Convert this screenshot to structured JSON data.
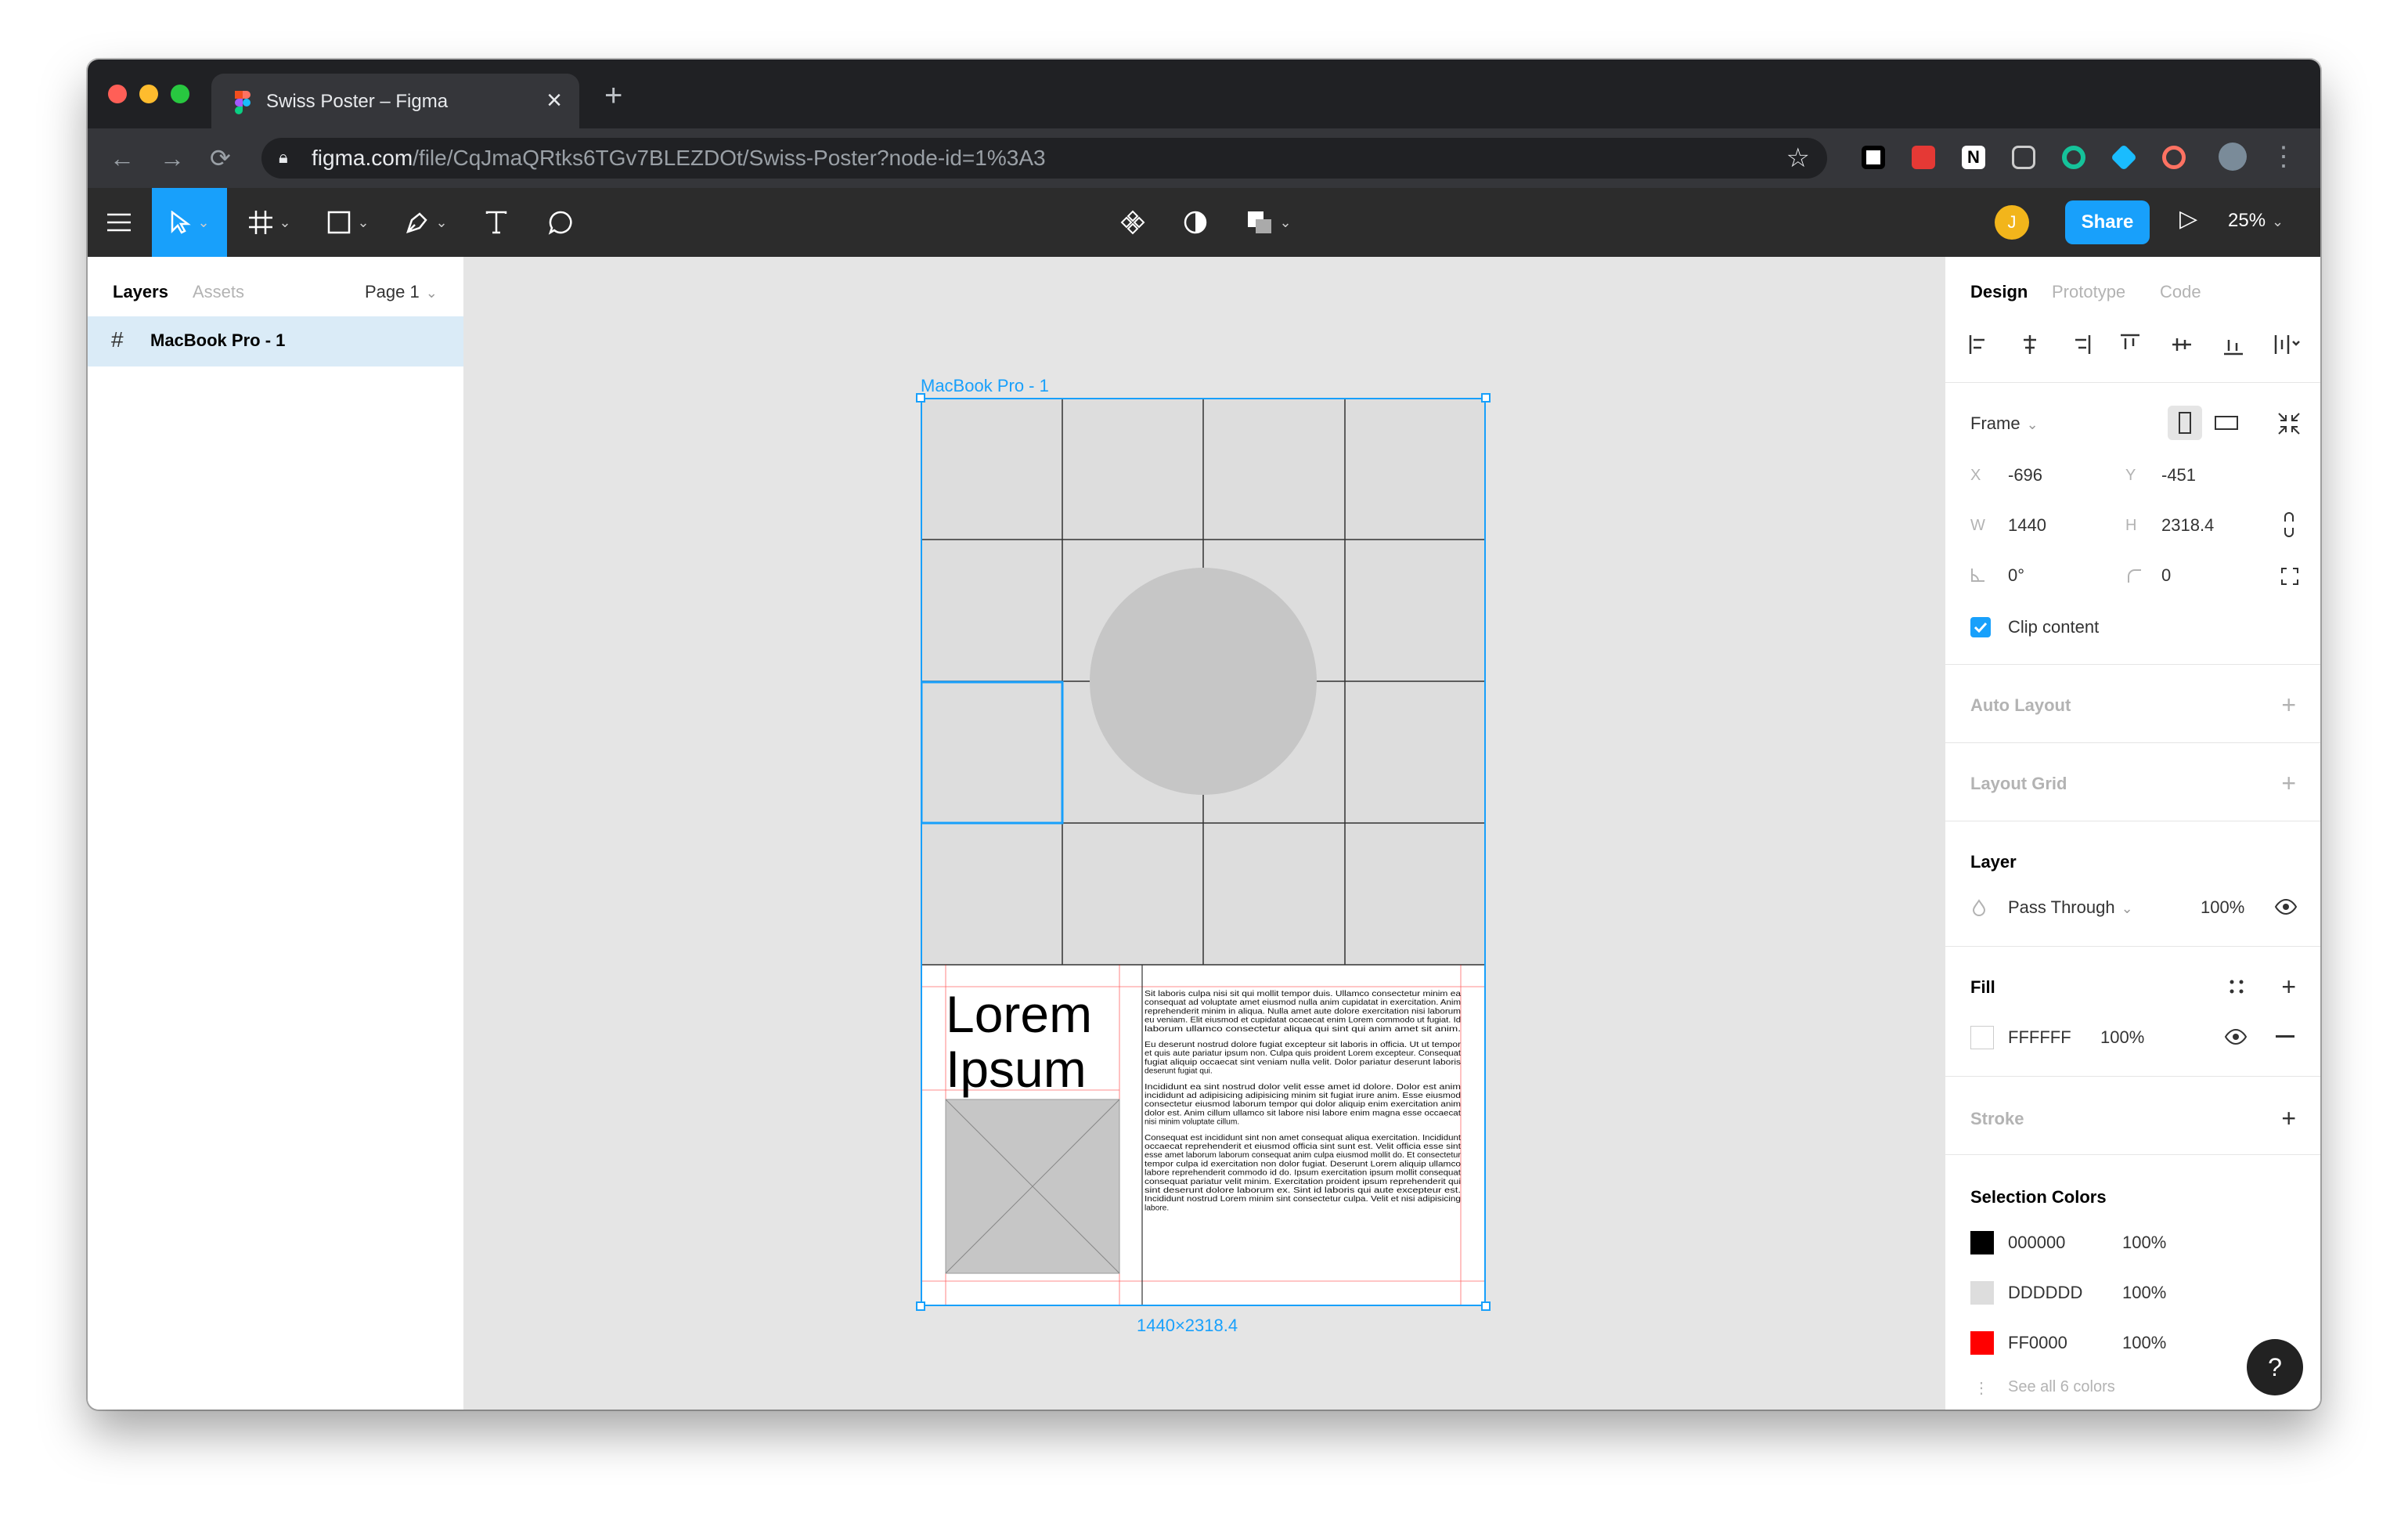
{
  "browser": {
    "tab_title": "Swiss Poster – Figma",
    "tab_close": "×",
    "new_tab": "+",
    "url_host": "figma.com",
    "url_path": "/file/CqJmaQRtks6TGv7BLEZDOt/Swiss-Poster?node-id=1%3A3",
    "back": "←",
    "forward": "→",
    "reload": "⟳",
    "star": "☆",
    "menu": "⋮"
  },
  "toolbar": {
    "avatar_initial": "J",
    "share_label": "Share",
    "play": "▷",
    "zoom": "25%"
  },
  "left_panel": {
    "tabs": [
      "Layers",
      "Assets"
    ],
    "page": "Page 1",
    "layers": [
      {
        "name": "MacBook Pro - 1"
      }
    ]
  },
  "canvas": {
    "frame_name": "MacBook Pro - 1",
    "dimensions": "1440×2318.4",
    "poster": {
      "heading_line1": "Lorem",
      "heading_line2": "Ipsum",
      "paragraphs": [
        "Sit laboris culpa nisi sit qui mollit tempor duis. Ullamco consectetur minim ea consequat ad voluptate amet eiusmod nulla anim cupidatat in exercitation. Anim reprehenderit minim in aliqua. Nulla amet aute dolore exercitation nisi laborum eu veniam. Elit eiusmod et cupidatat occaecat enim Lorem commodo ut fugiat. Id laborum ullamco consectetur aliqua qui sint qui anim amet sit anim.",
        "Eu deserunt nostrud dolore fugiat excepteur sit laboris in officia. Ut ut tempor et quis aute pariatur ipsum non. Culpa quis proident Lorem excepteur. Consequat fugiat aliquip occaecat sint veniam nulla velit. Dolor pariatur deserunt laboris deserunt fugiat qui.",
        "Incididunt ea sint nostrud dolor velit esse amet id dolore. Dolor est anim incididunt ad adipisicing adipisicing minim sit fugiat irure anim. Esse eiusmod consectetur eiusmod laborum tempor qui dolor aliquip enim exercitation anim dolor est. Anim cillum ullamco sit labore nisi labore enim magna esse occaecat nisi minim voluptate cillum.",
        "Consequat est incididunt sint non amet consequat aliqua exercitation. Incididunt occaecat reprehenderit et eiusmod officia sint sunt est. Velit officia esse sint esse amet laborum laborum consequat anim culpa eiusmod mollit do. Et consectetur tempor culpa id exercitation non dolor fugiat. Deserunt Lorem aliquip ullamco labore reprehenderit commodo id do. Ipsum exercitation ipsum mollit consequat consequat pariatur velit minim. Exercitation proident ipsum reprehenderit qui sint deserunt dolore laborum ex. Sint id laboris qui aute excepteur est. Incididunt nostrud Lorem minim sint consectetur culpa. Velit et nisi adipisicing labore."
      ]
    }
  },
  "right_panel": {
    "tabs": [
      "Design",
      "Prototype",
      "Code"
    ],
    "frame": {
      "label": "Frame",
      "x_label": "X",
      "x": "-696",
      "y_label": "Y",
      "y": "-451",
      "w_label": "W",
      "w": "1440",
      "h_label": "H",
      "h": "2318.4",
      "rotation": "0°",
      "radius": "0",
      "clip_content": "Clip content"
    },
    "auto_layout": "Auto Layout",
    "layout_grid": "Layout Grid",
    "layer": {
      "title": "Layer",
      "blend": "Pass Through",
      "opacity": "100%"
    },
    "fill": {
      "title": "Fill",
      "hex": "FFFFFF",
      "opacity": "100%"
    },
    "stroke": "Stroke",
    "selection_colors": {
      "title": "Selection Colors",
      "colors": [
        {
          "hex": "000000",
          "opacity": "100%",
          "swatch": "#000000"
        },
        {
          "hex": "DDDDDD",
          "opacity": "100%",
          "swatch": "#DDDDDD"
        },
        {
          "hex": "FF0000",
          "opacity": "100%",
          "swatch": "#FF0000"
        }
      ],
      "see_all": "See all 6 colors"
    },
    "help": "?"
  }
}
